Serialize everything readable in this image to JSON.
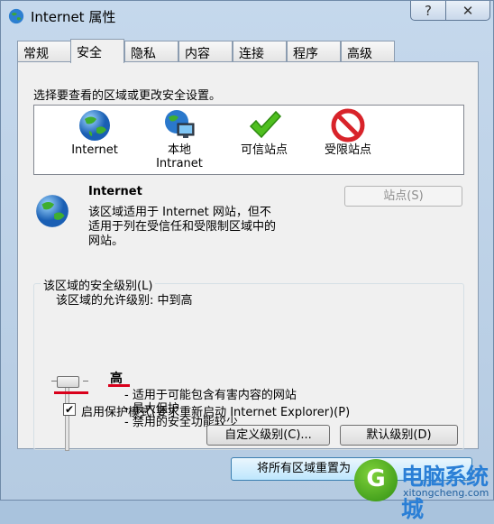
{
  "window": {
    "title": "Internet 属性",
    "help_icon": "help-icon",
    "close_icon": "close-icon"
  },
  "tabs": [
    {
      "label": "常规"
    },
    {
      "label": "安全"
    },
    {
      "label": "隐私"
    },
    {
      "label": "内容"
    },
    {
      "label": "连接"
    },
    {
      "label": "程序"
    },
    {
      "label": "高级"
    }
  ],
  "active_tab": "安全",
  "security": {
    "instruction": "选择要查看的区域或更改安全设置。",
    "zones": [
      {
        "label": "Internet",
        "icon": "globe-icon"
      },
      {
        "label": "本地\nIntranet",
        "icon": "intranet-computer-icon"
      },
      {
        "label": "可信站点",
        "icon": "green-check-icon"
      },
      {
        "label": "受限站点",
        "icon": "red-prohibited-icon"
      }
    ],
    "selected_zone": {
      "name": "Internet",
      "description_lines": [
        "该区域适用于 Internet 网站，但不",
        "适用于列在受信任和受限制区域中的",
        "网站。"
      ],
      "sites_button": "站点(S)"
    },
    "level_group": {
      "title": "该区域的安全级别(L)",
      "allowed_levels": "该区域的允许级别: 中到高",
      "current_level": "高",
      "level_points": [
        "- 适用于可能包含有害内容的网站",
        "- 最大保护",
        "- 禁用的安全功能较少"
      ],
      "protected_mode_label": "启用保护模式(要求重新启动 Internet Explorer)(P)",
      "protected_mode_checked": true,
      "custom_level_button": "自定义级别(C)...",
      "default_level_button": "默认级别(D)"
    },
    "reset_all_button": "将所有区域重置为"
  },
  "watermark": {
    "badge": "G",
    "text": "电脑系统城",
    "sub": "xitongcheng.com"
  },
  "colors": {
    "accent_red": "#d9001b",
    "title_bg": "#b5cbe2"
  }
}
